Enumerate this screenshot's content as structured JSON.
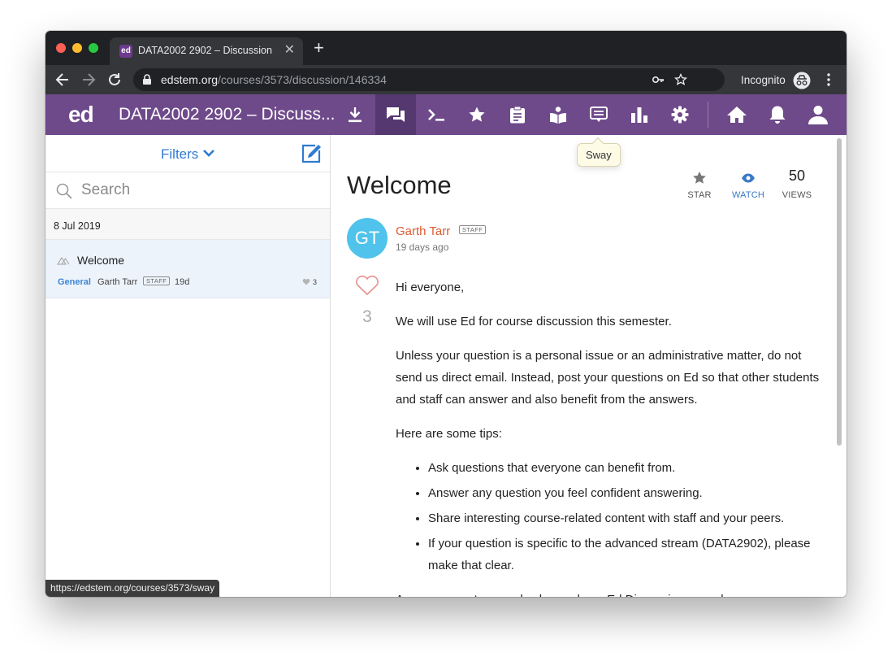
{
  "browser": {
    "tab_title": "DATA2002 2902 – Discussion",
    "tab_favicon_text": "ed",
    "url_host": "edstem.org",
    "url_path": "/courses/3573/discussion/146334",
    "incognito_label": "Incognito",
    "status_url": "https://edstem.org/courses/3573/sway"
  },
  "app": {
    "logo": "ed",
    "course_title": "DATA2002 2902 – Discuss...",
    "accent_color": "#6e4a8a",
    "nav_icons": [
      "download-icon",
      "discussion-icon",
      "terminal-icon",
      "star-icon",
      "clipboard-icon",
      "lessons-icon",
      "sway-icon",
      "analytics-icon",
      "settings-icon",
      "home-icon",
      "bell-icon",
      "user-icon"
    ],
    "tooltip": "Sway"
  },
  "sidebar": {
    "filters_label": "Filters",
    "search_placeholder": "Search",
    "date_header": "8 Jul 2019",
    "threads": [
      {
        "title": "Welcome",
        "category": "General",
        "author": "Garth Tarr",
        "badge": "STAFF",
        "age": "19d",
        "likes": "3"
      }
    ]
  },
  "post": {
    "title": "Welcome",
    "star_label": "STAR",
    "watch_label": "WATCH",
    "views_count": "50",
    "views_label": "VIEWS",
    "avatar_initials": "GT",
    "author": "Garth Tarr",
    "author_badge": "STAFF",
    "age": "19 days ago",
    "likes": "3",
    "paragraphs": [
      "Hi everyone,",
      "We will use Ed for course discussion this semester.",
      "Unless your question is a personal issue or an administrative matter, do not send us direct email. Instead, post your questions on Ed so that other students and staff can answer and also benefit from the answers.",
      "Here are some tips:"
    ],
    "tips": [
      "Ask questions that everyone can benefit from.",
      "Answer any question you feel confident answering.",
      "Share interesting course-related content with staff and your peers.",
      "If your question is specific to the advanced stream (DATA2902), please make that clear."
    ],
    "trailing_text": "Announcements may also be made on Ed Discussion so make sure you"
  }
}
